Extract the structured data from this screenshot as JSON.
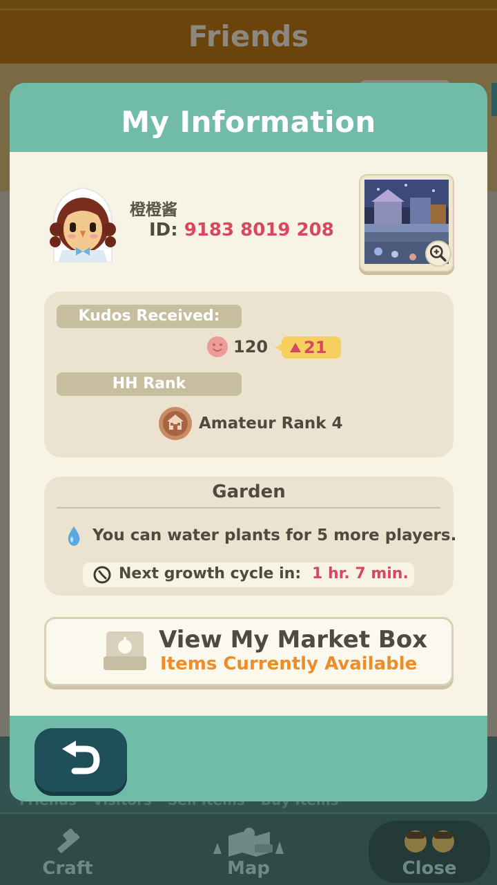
{
  "background": {
    "title": "Friends",
    "subtabs": [
      "Friends",
      "Visitors",
      "Sell Items",
      "Buy Items"
    ]
  },
  "bottom_nav": {
    "craft": {
      "label": "Craft",
      "icon": "hammer-icon"
    },
    "map": {
      "label": "Map",
      "icon": "map-icon"
    },
    "close": {
      "label": "Close",
      "icon": "villagers-icon"
    }
  },
  "dialog": {
    "title": "My Information",
    "profile": {
      "name": "橙橙酱",
      "id_label": "ID:",
      "id_value": "9183 8019 208"
    },
    "kudos": {
      "label": "Kudos Received:",
      "value": "120",
      "delta": "21"
    },
    "rank": {
      "label": "HH Rank",
      "value": "Amateur Rank 4"
    },
    "garden": {
      "title": "Garden",
      "water_text": "You can water plants for 5 more players.",
      "growth_label": "Next growth cycle in:",
      "growth_value": "1 hr. 7 min."
    },
    "market": {
      "title": "View My Market Box",
      "subtitle": "Items Currently Available"
    }
  },
  "colors": {
    "teal": "#71bca9",
    "cream": "#f7f3e5",
    "accent_red": "#d6485d",
    "accent_orange": "#ec8d2a",
    "back_button": "#1f4f59"
  }
}
